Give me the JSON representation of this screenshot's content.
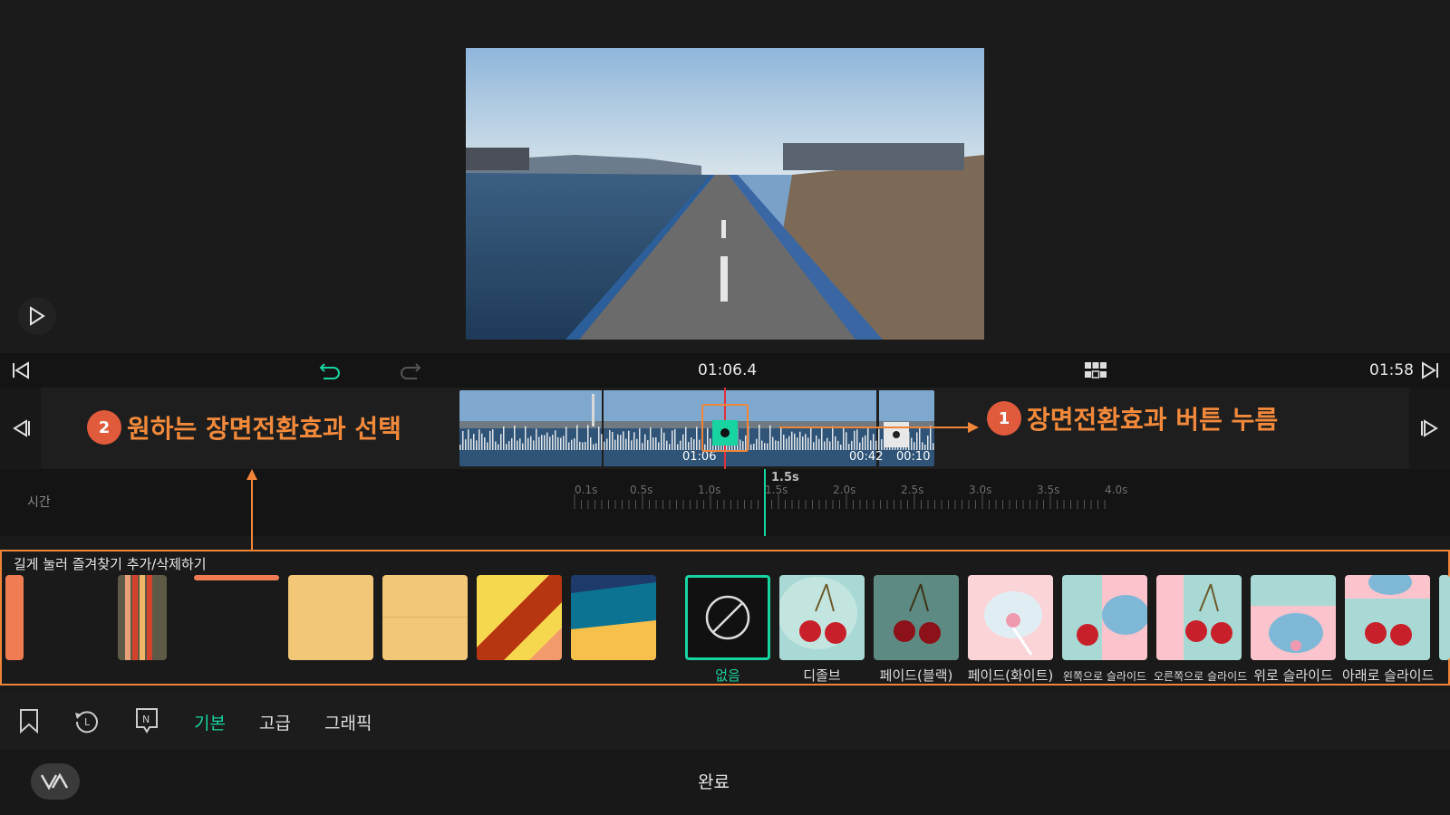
{
  "preview": {
    "current_time": "01:06.4",
    "total_time": "01:58"
  },
  "clip": {
    "label_left": "01:06",
    "label_mid": "00:42",
    "label_right": "00:10"
  },
  "annotations": {
    "step1_number": "1",
    "step1_text": "장면전환효과 버튼 누름",
    "step2_number": "2",
    "step2_text": "원하는 장면전환효과 선택"
  },
  "duration": {
    "label": "시간",
    "selected": "1.5s",
    "ticks": [
      "0.1s",
      "0.5s",
      "1.0s",
      "1.5s",
      "2.0s",
      "2.5s",
      "3.0s",
      "3.5s",
      "4.0s"
    ]
  },
  "effects": {
    "hint": "길게 눌러 즐겨찾기 추가/삭제하기",
    "items": [
      {
        "label": "없음"
      },
      {
        "label": "디졸브"
      },
      {
        "label": "페이드(블랙)"
      },
      {
        "label": "페이드(화이트)"
      },
      {
        "label": "왼쪽으로 슬라이드"
      },
      {
        "label": "오른쪽으로 슬라이드"
      },
      {
        "label": "위로 슬라이드"
      },
      {
        "label": "아래로 슬라이드"
      }
    ]
  },
  "tabs": {
    "basic": "기본",
    "advanced": "고급",
    "graphic": "그래픽"
  },
  "footer": {
    "done": "완료"
  },
  "colors": {
    "accent": "#17d4a0",
    "annotation": "#f38a3b",
    "badge": "#e05b3c"
  }
}
